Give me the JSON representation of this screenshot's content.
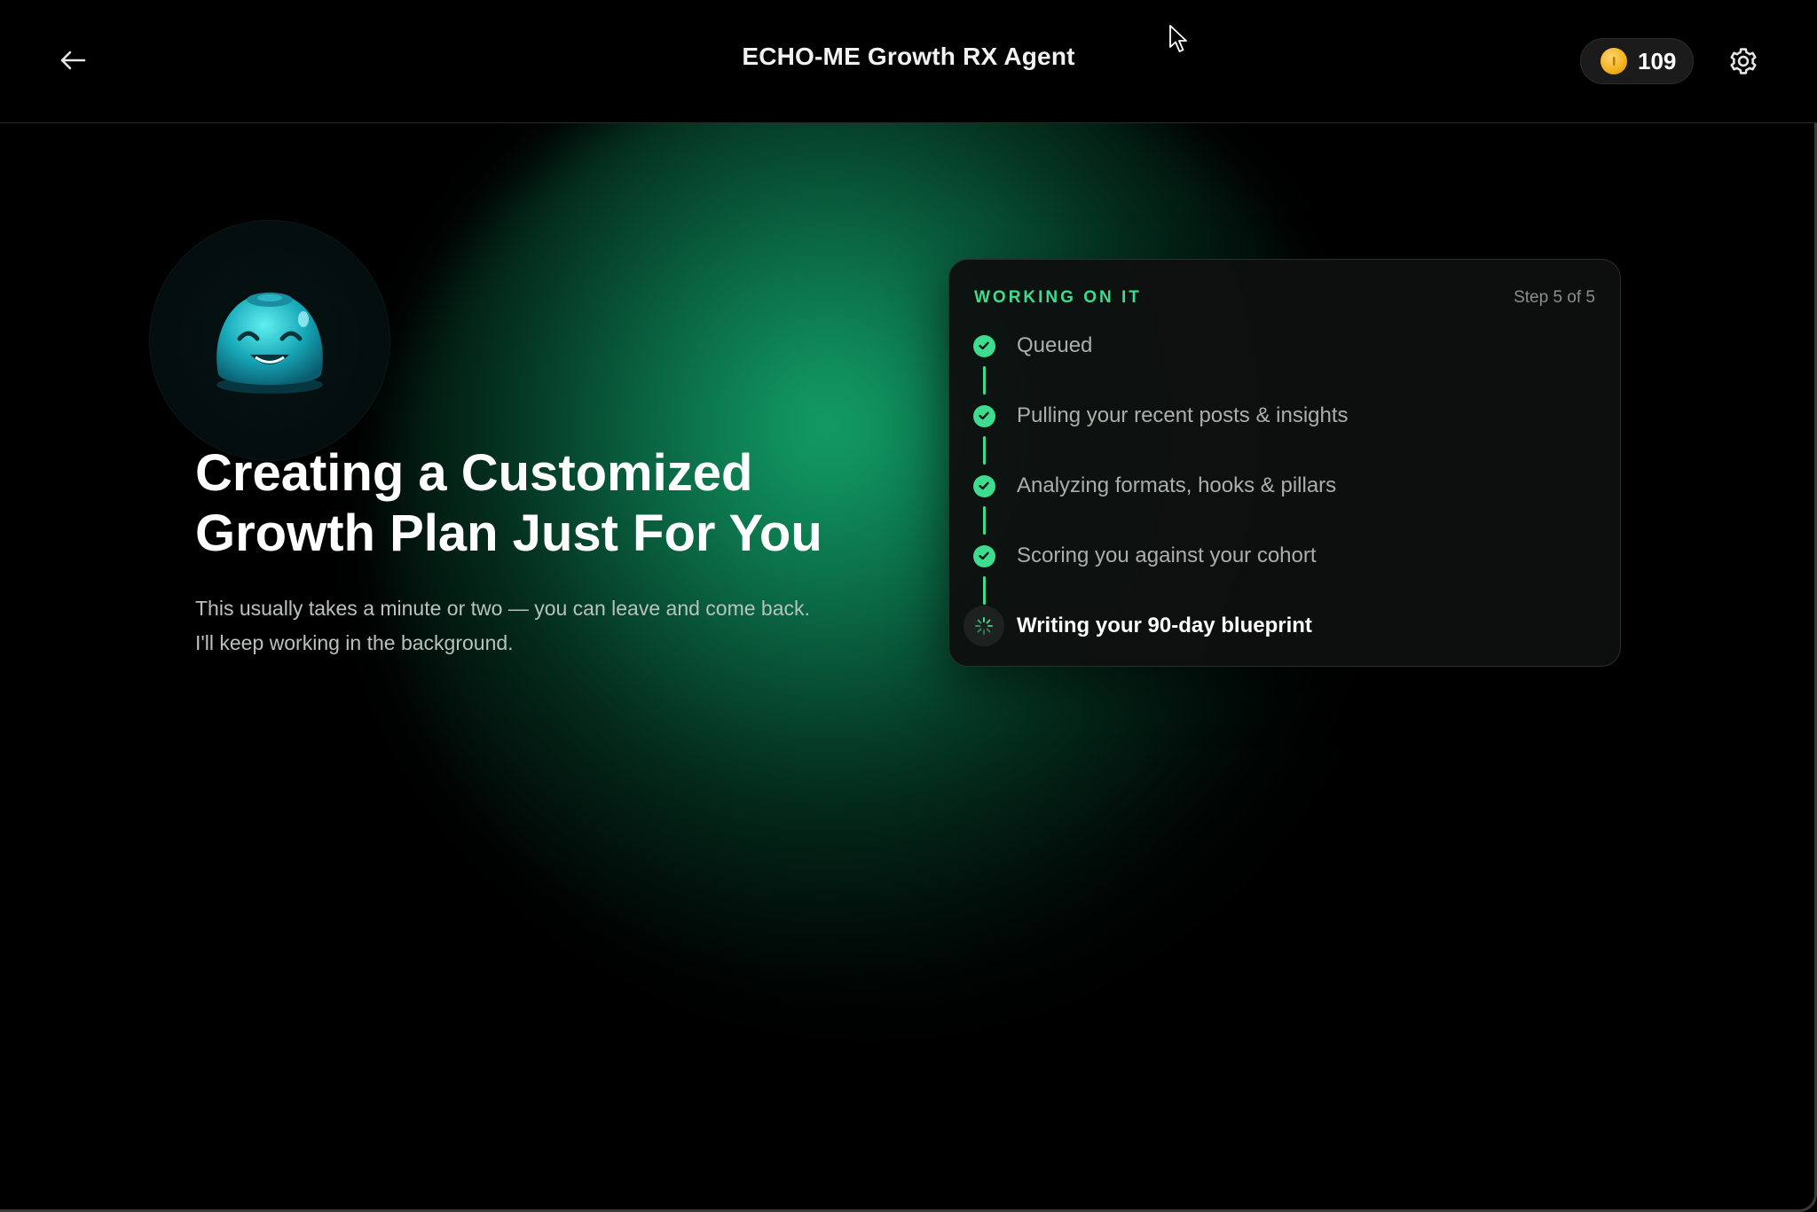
{
  "header": {
    "title": "ECHO-ME Growth RX Agent",
    "coins": "109",
    "back_icon": "arrow-left-icon",
    "coin_icon": "coin-icon",
    "settings_icon": "gear-icon"
  },
  "hero": {
    "headline_line1": "Creating a Customized",
    "headline_line2": "Growth Plan Just For You",
    "sub_line1": "This usually takes a minute or two — you can leave and come back.",
    "sub_line2": "I'll keep working in the background."
  },
  "progress": {
    "status": "WORKING ON IT",
    "step_counter": "Step 5 of 5",
    "steps": [
      {
        "label": "Queued",
        "state": "done"
      },
      {
        "label": "Pulling your recent posts & insights",
        "state": "done"
      },
      {
        "label": "Analyzing formats, hooks & pillars",
        "state": "done"
      },
      {
        "label": "Scoring you against your cohort",
        "state": "done"
      },
      {
        "label": "Writing your 90-day blueprint",
        "state": "in-progress"
      }
    ]
  },
  "colors": {
    "accent": "#3ddc8e",
    "background": "#000000",
    "coin": "#f2b01e"
  }
}
